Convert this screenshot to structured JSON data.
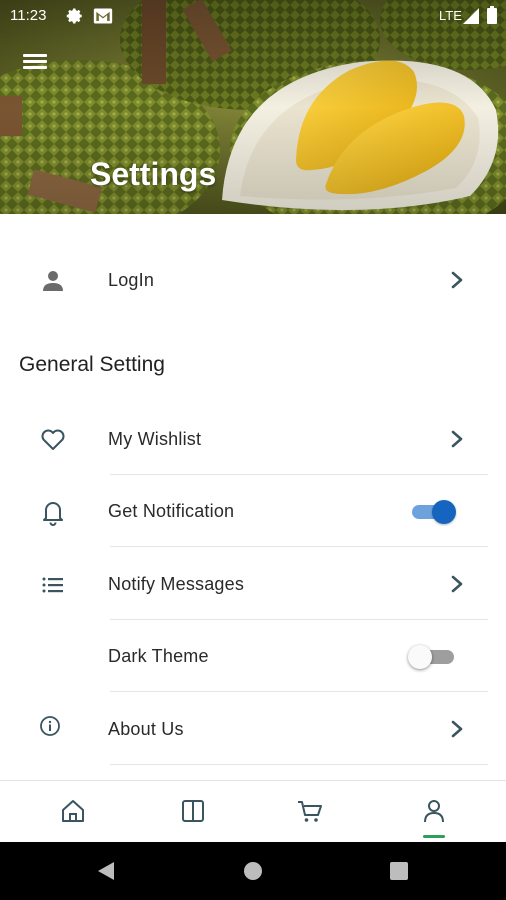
{
  "status_bar": {
    "time": "11:23",
    "network": "LTE"
  },
  "header": {
    "title": "Settings"
  },
  "login": {
    "label": "LogIn"
  },
  "general": {
    "section_title": "General Setting",
    "items": [
      {
        "label": "My Wishlist",
        "control": "chevron"
      },
      {
        "label": "Get Notification",
        "control": "toggle",
        "value": "on"
      },
      {
        "label": "Notify Messages",
        "control": "chevron"
      },
      {
        "label": "Dark Theme",
        "control": "toggle",
        "value": "off"
      },
      {
        "label": "About Us",
        "control": "chevron"
      }
    ]
  },
  "bottom_nav": {
    "items": [
      "home-icon",
      "book-icon",
      "cart-icon",
      "person-icon"
    ],
    "active": "person-icon"
  },
  "colors": {
    "icon": "#3a5560",
    "toggle_on": "#1565c0",
    "nav_active_indicator": "#2e9e5a"
  }
}
